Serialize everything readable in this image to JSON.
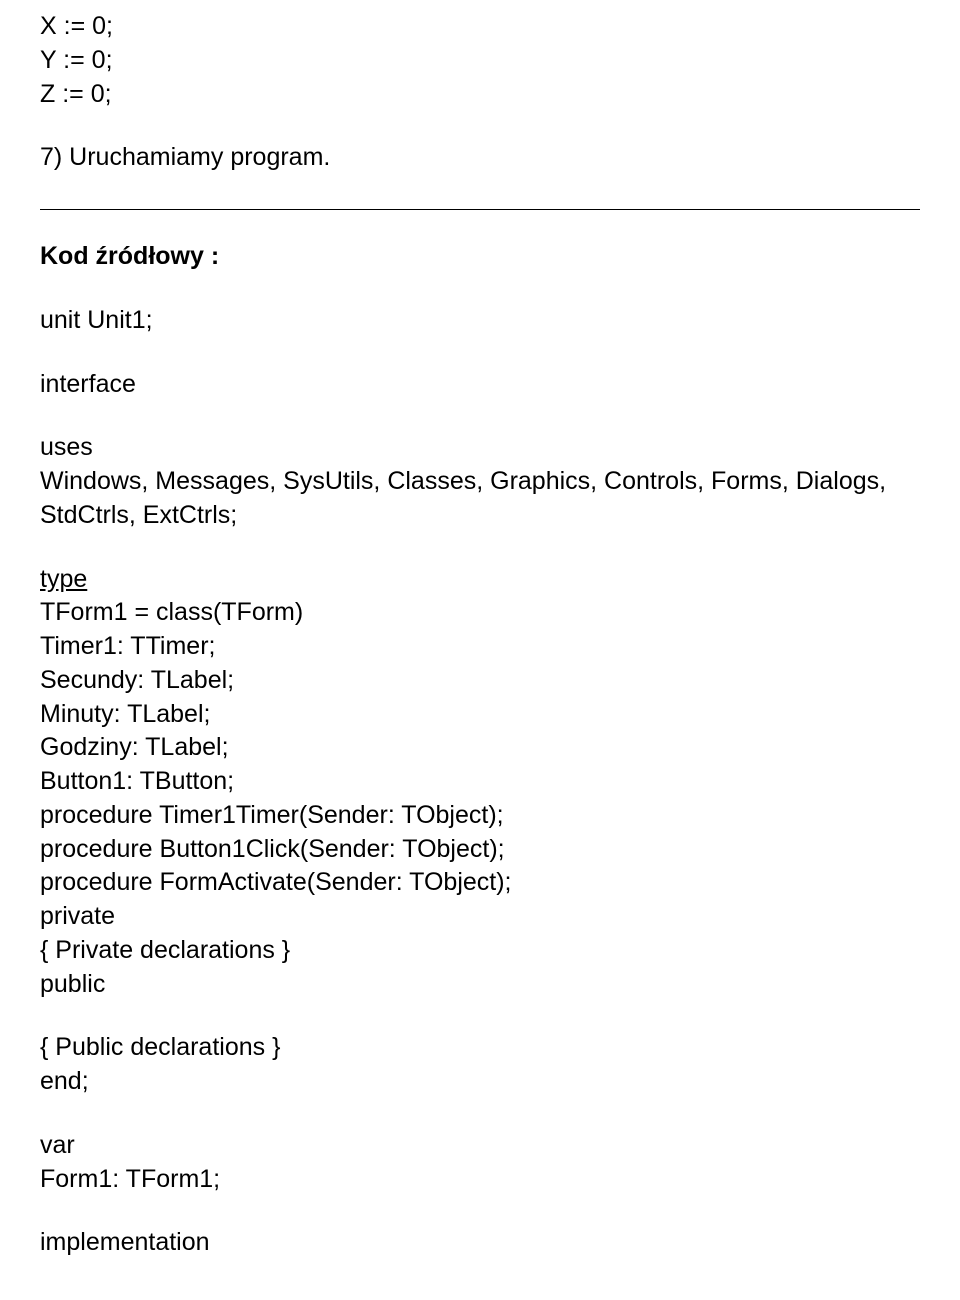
{
  "code_init": "X := 0;\nY := 0;\nZ := 0;",
  "step7": "7) Uruchamiamy program.",
  "heading": "Kod źródłowy :",
  "unit_line": "unit Unit1;",
  "interface_line": "interface",
  "uses_kw": "uses",
  "uses_body": "Windows, Messages, SysUtils, Classes, Graphics, Controls, Forms, Dialogs,\nStdCtrls, ExtCtrls;",
  "type_kw": "type",
  "class_body": "TForm1 = class(TForm)\nTimer1: TTimer;\nSecundy: TLabel;\nMinuty: TLabel;\nGodziny: TLabel;\nButton1: TButton;\nprocedure Timer1Timer(Sender: TObject);\nprocedure Button1Click(Sender: TObject);\nprocedure FormActivate(Sender: TObject);\nprivate\n{ Private declarations }\npublic",
  "public_decl": "{ Public declarations }\nend;",
  "var_kw": "var",
  "var_body": "Form1: TForm1;",
  "impl_line": "implementation"
}
